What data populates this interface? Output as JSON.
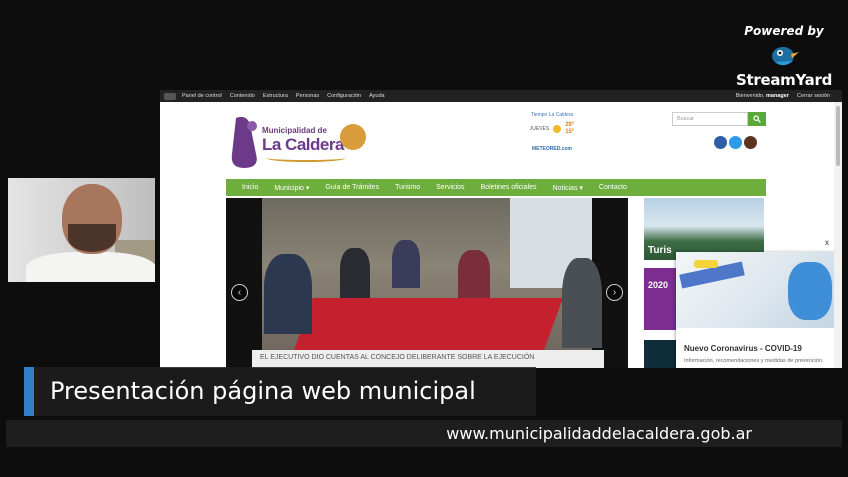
{
  "branding": {
    "powered_by": "Powered by",
    "product": "StreamYard"
  },
  "browser": {
    "admin_bar": {
      "items": [
        "Panel de control",
        "Contenido",
        "Estructura",
        "Personas",
        "Configuración",
        "Ayuda"
      ],
      "welcome": "Bienvenido,",
      "user": "manager",
      "logout": "Cerrar sesión"
    }
  },
  "site": {
    "logo": {
      "line1": "Municipalidad de",
      "line2": "La Caldera"
    },
    "weather": {
      "title": "Tiempo La Caldera",
      "day": "JUEVES",
      "high": "29°",
      "low": "15°",
      "provider": "METEORED",
      "provider_suffix": ".com"
    },
    "search": {
      "placeholder": "Buscar"
    },
    "nav": [
      "Inicio",
      "Municipio ▾",
      "Guía de Trámites",
      "Turismo",
      "Servicios",
      "Boletines oficiales",
      "Noticias ▾",
      "Contacto"
    ],
    "hero": {
      "caption": "EL EJECUTIVO DIO CUENTAS AL CONCEJO DELIBERANTE SOBRE LA EJECUCIÓN"
    },
    "sidebar": {
      "tourism_label": "Turis",
      "year": "2020"
    },
    "popup": {
      "close": "x",
      "title": "Nuevo Coronavirus - COVID-19",
      "description": "Información, recomendaciones y medidas de prevención."
    }
  },
  "overlay": {
    "title": "Presentación página web municipal",
    "url": "www.municipalidaddelacaldera.gob.ar"
  },
  "colors": {
    "nav_green": "#6eae3d",
    "accent_blue": "#2f80c4",
    "logo_purple": "#6d3a8a"
  }
}
